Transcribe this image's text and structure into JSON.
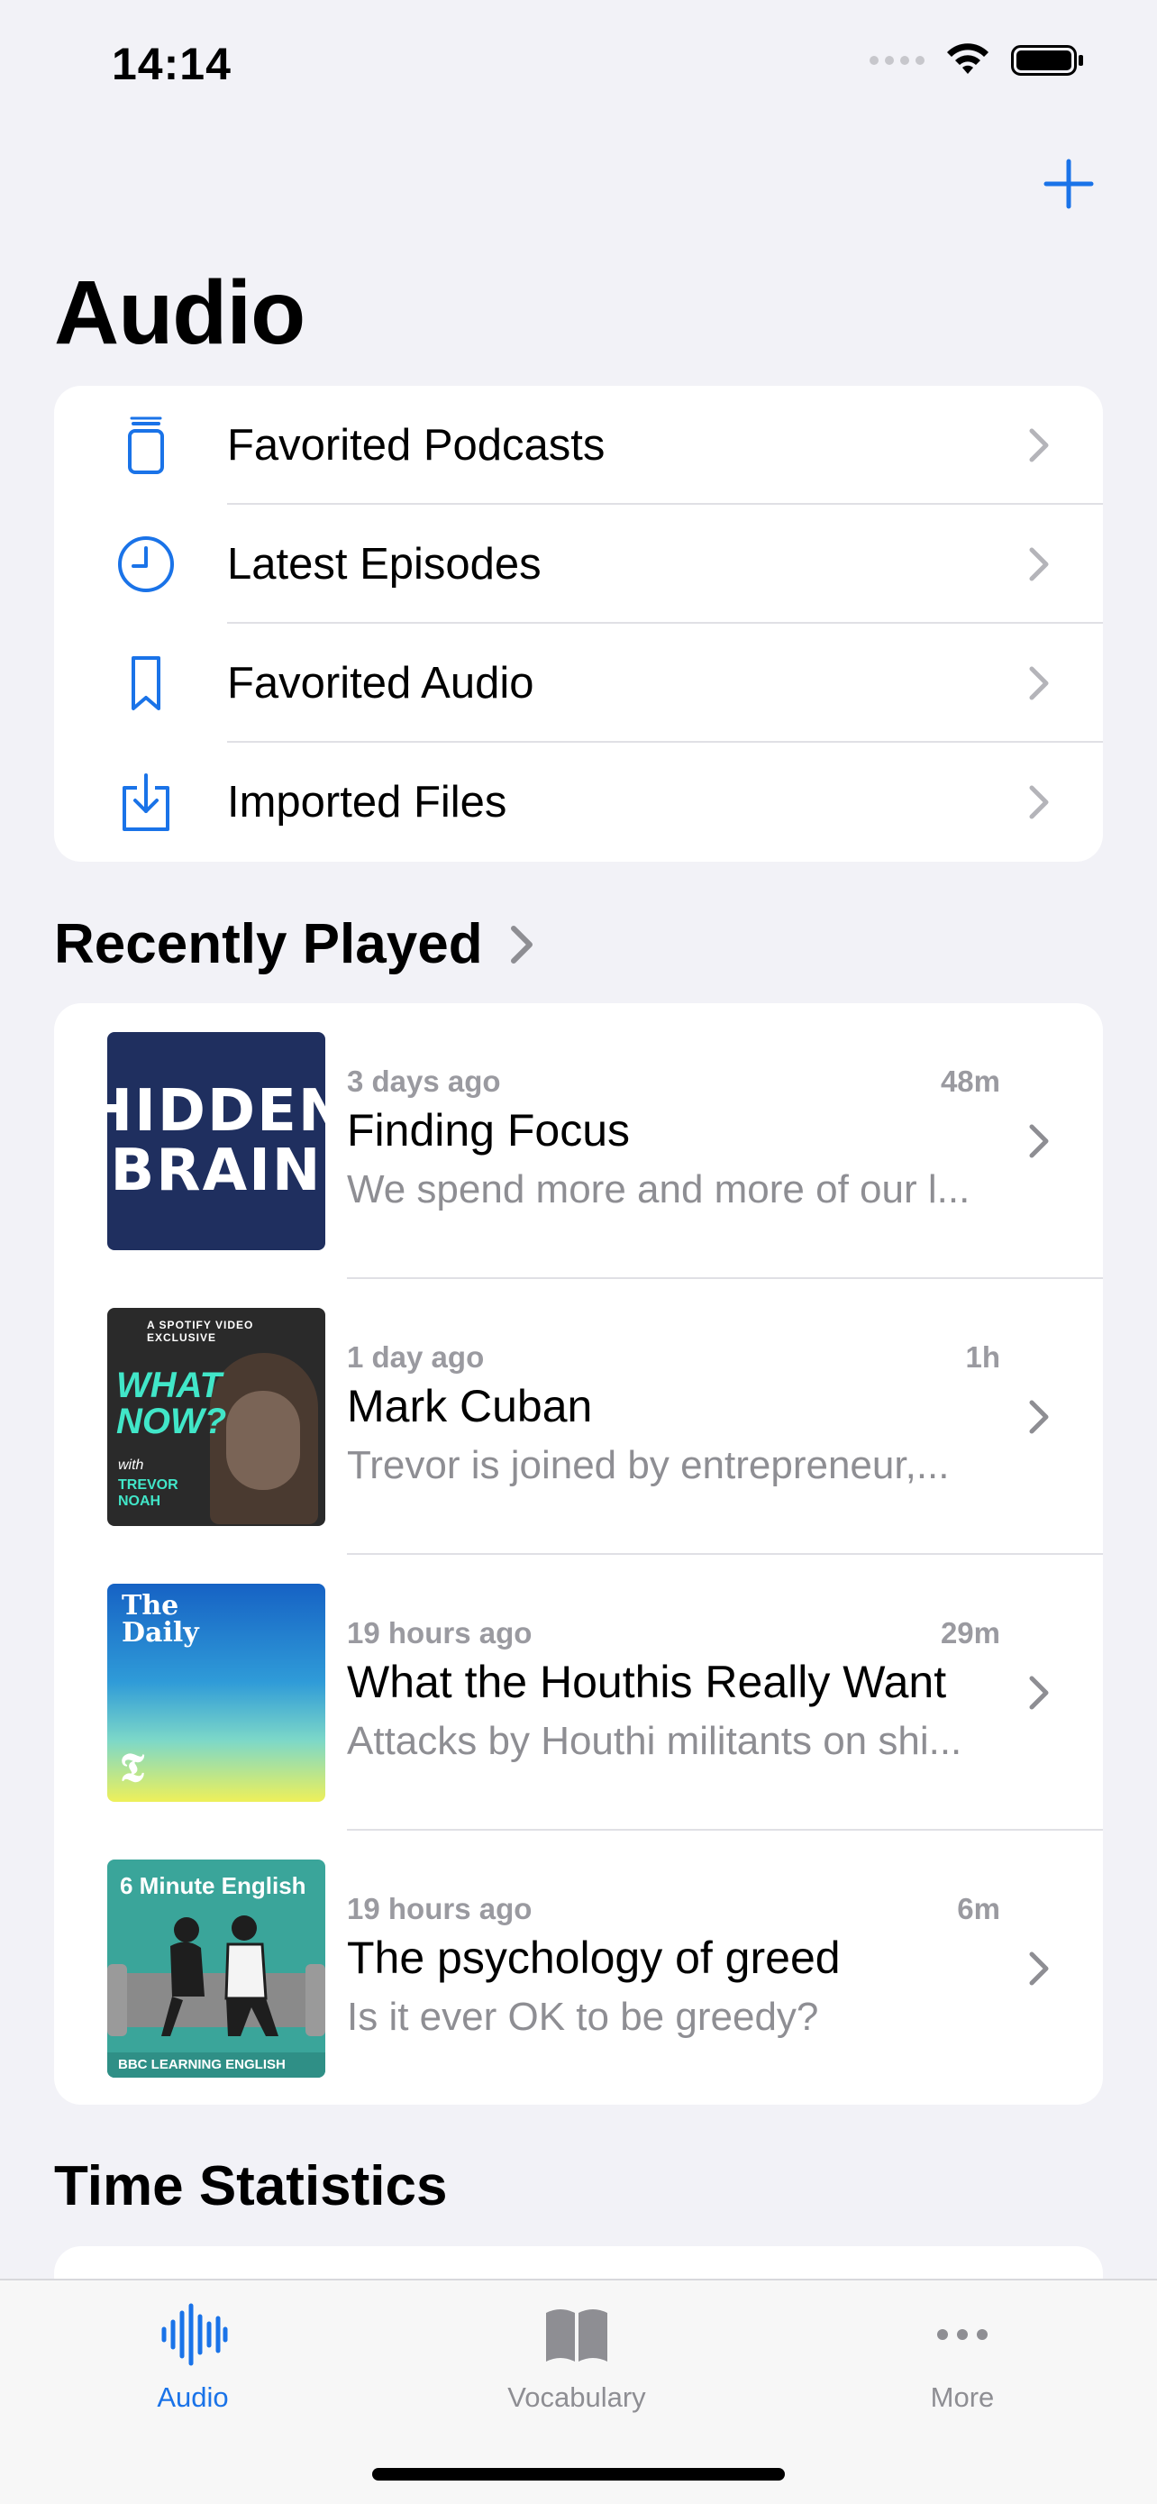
{
  "status_bar": {
    "time": "14:14"
  },
  "page": {
    "title": "Audio"
  },
  "menu": [
    {
      "label": "Favorited Podcasts",
      "icon": "podcasts-stack-icon"
    },
    {
      "label": "Latest Episodes",
      "icon": "clock-icon"
    },
    {
      "label": "Favorited Audio",
      "icon": "bookmark-icon"
    },
    {
      "label": "Imported Files",
      "icon": "import-icon"
    }
  ],
  "recently_played": {
    "header": "Recently Played",
    "episodes": [
      {
        "when": "3 days ago",
        "duration": "48m",
        "title": "Finding Focus",
        "description": "We spend more and more of our l...",
        "artwork_text": [
          "HIDDEN",
          "BRAIN"
        ]
      },
      {
        "when": "1 day ago",
        "duration": "1h",
        "title": "Mark Cuban",
        "description": "Trevor is joined by entrepreneur,...",
        "artwork_text": [
          "A SPOTIFY VIDEO EXCLUSIVE",
          "WHAT",
          "NOW?",
          "with",
          "TREVOR",
          "NOAH"
        ]
      },
      {
        "when": "19 hours ago",
        "duration": "29m",
        "title": "What the Houthis Really Want",
        "description": "Attacks by Houthi militants on shi...",
        "artwork_text": [
          "The",
          "Daily"
        ]
      },
      {
        "when": "19 hours ago",
        "duration": "6m",
        "title": "The psychology of greed",
        "description": "Is it ever OK to be greedy?",
        "artwork_text": [
          "6 Minute English",
          "BBC LEARNING ENGLISH"
        ]
      }
    ]
  },
  "time_statistics": {
    "header": "Time Statistics"
  },
  "tab_bar": {
    "tabs": [
      {
        "label": "Audio",
        "icon": "waveform-icon",
        "active": true
      },
      {
        "label": "Vocabulary",
        "icon": "book-icon",
        "active": false
      },
      {
        "label": "More",
        "icon": "ellipsis-icon",
        "active": false
      }
    ]
  },
  "colors": {
    "accent": "#1a73e8",
    "background": "#f2f2f7",
    "secondary_text": "#8e8e93"
  }
}
